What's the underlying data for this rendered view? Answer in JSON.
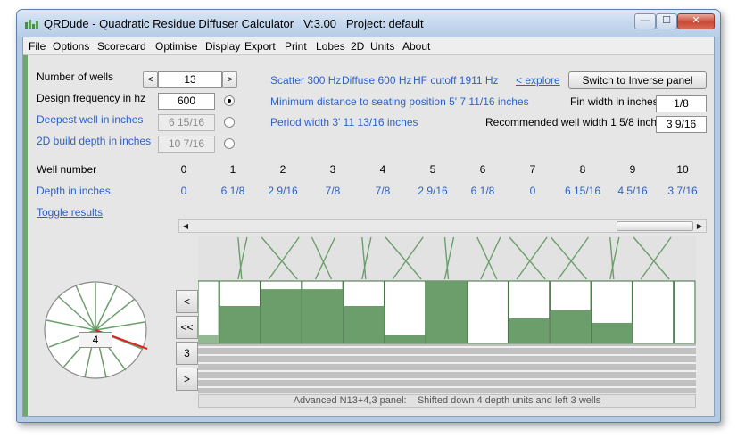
{
  "window": {
    "title": "QRDude - Quadratic Residue Diffuser Calculator   V:3.00   Project: default",
    "min_glyph": "—",
    "max_glyph": "☐",
    "close_glyph": "✕"
  },
  "menu": [
    "File",
    "Options",
    "Scorecard",
    "Optimise",
    "Display",
    "Export",
    "Print",
    "Lobes",
    "2D",
    "Units",
    "About"
  ],
  "params": {
    "number_of_wells_label": "Number of wells",
    "number_of_wells_value": "13",
    "spin_down": "<",
    "spin_up": ">",
    "design_freq_label": "Design frequency in hz",
    "design_freq_value": "600",
    "deepest_well_label": "Deepest well in inches",
    "deepest_well_value": "6 15/16",
    "build_depth_label": "2D build depth in inches",
    "build_depth_value": "10 7/16",
    "selected_radio": "design_freq"
  },
  "info": {
    "scatter": "Scatter 300 Hz",
    "diffuse": "Diffuse 600 Hz",
    "hf_cutoff": "HF cutoff 1911 Hz",
    "explore_link": "< explore",
    "switch_button": "Switch to Inverse panel",
    "min_distance": "Minimum distance to seating position 5' 7 11/16 inches",
    "period_width": "Period width 3' 11 13/16 inches",
    "fin_width_label": "Fin width in inches",
    "fin_width_value": "1/8",
    "rec_well_label": "Recommended well width 1 5/8 inches",
    "rec_well_value": "3 9/16"
  },
  "table": {
    "well_number_label": "Well number",
    "depth_label": "Depth in inches",
    "wells": [
      "0",
      "1",
      "2",
      "3",
      "4",
      "5",
      "6",
      "7",
      "8",
      "9",
      "10"
    ],
    "depths": [
      "0",
      "6 1/8",
      "2 9/16",
      "7/8",
      "7/8",
      "2 9/16",
      "6 1/8",
      "0",
      "6 15/16",
      "4 5/16",
      "3 7/16"
    ],
    "toggle_results": "Toggle results"
  },
  "panel": {
    "well_fill": [
      0.13,
      0.6,
      0.87,
      0.87,
      0.6,
      0.13,
      1.0,
      0.0,
      0.4,
      0.53,
      0.33,
      0.0,
      0.0
    ],
    "fill_color": "#6c9e6c",
    "empty_color": "#ffffff",
    "side_buttons": [
      "<",
      "<<",
      "3",
      ">"
    ],
    "status": "Advanced N13+4,3 panel:    Shifted down 4 depth units and left 3 wells"
  },
  "dial": {
    "value": "4"
  }
}
